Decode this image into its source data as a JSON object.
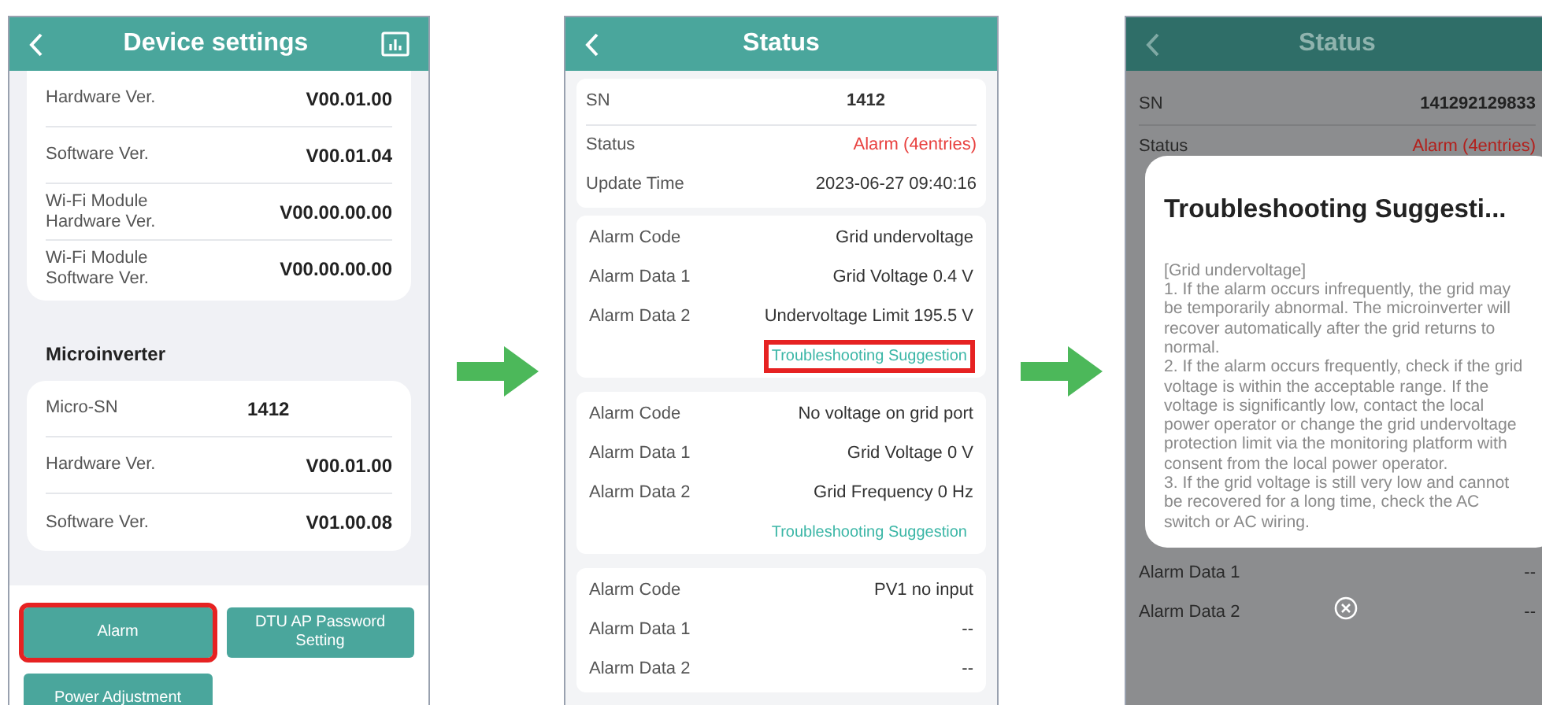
{
  "device_settings_screen": {
    "title": "Device settings",
    "dtu_rows": [
      {
        "label": "Hardware Ver.",
        "value": "V00.01.00"
      },
      {
        "label": "Software Ver.",
        "value": "V00.01.04"
      },
      {
        "label": "Wi-Fi Module Hardware Ver.",
        "value": "V00.00.00.00"
      },
      {
        "label": "Wi-Fi Module Software Ver.",
        "value": "V00.00.00.00"
      }
    ],
    "microinverter_heading": "Microinverter",
    "microinverter_rows": [
      {
        "label": "Micro-SN",
        "value": "1412",
        "kind": "serial"
      },
      {
        "label": "Hardware Ver.",
        "value": "V00.01.00",
        "kind": "version"
      },
      {
        "label": "Software Ver.",
        "value": "V01.00.08",
        "kind": "version"
      }
    ],
    "buttons": [
      {
        "label": "Alarm",
        "highlighted": true
      },
      {
        "label": "DTU AP Password Setting",
        "highlighted": false
      },
      {
        "label": "Power Adjustment",
        "highlighted": false
      }
    ]
  },
  "status_screen": {
    "title": "Status",
    "summary_rows": [
      {
        "label": "SN",
        "value": "1412",
        "kind": "serial"
      },
      {
        "label": "Status",
        "value": "Alarm (4entries)",
        "kind": "alarm"
      },
      {
        "label": "Update Time",
        "value": "2023-06-27 09:40:16",
        "kind": "plain"
      }
    ],
    "alarms": [
      {
        "rows": [
          {
            "label": "Alarm Code",
            "value": "Grid undervoltage"
          },
          {
            "label": "Alarm Data 1",
            "value": "Grid Voltage 0.4 V"
          },
          {
            "label": "Alarm Data 2",
            "value": "Undervoltage Limit 195.5 V"
          }
        ],
        "link": {
          "label": "Troubleshooting Suggestion",
          "highlighted": true
        }
      },
      {
        "rows": [
          {
            "label": "Alarm Code",
            "value": "No voltage on grid port"
          },
          {
            "label": "Alarm Data 1",
            "value": "Grid Voltage 0 V"
          },
          {
            "label": "Alarm Data 2",
            "value": "Grid Frequency 0 Hz"
          }
        ],
        "link": {
          "label": "Troubleshooting Suggestion",
          "highlighted": false
        }
      },
      {
        "rows": [
          {
            "label": "Alarm Code",
            "value": "PV1 no input"
          },
          {
            "label": "Alarm Data 1",
            "value": "--"
          },
          {
            "label": "Alarm Data 2",
            "value": "--"
          }
        ]
      }
    ]
  },
  "dialog_screen": {
    "title": "Status",
    "rows_above": [
      {
        "label": "SN",
        "value": "141292129833",
        "kind": "serial"
      },
      {
        "label": "Status",
        "value": "Alarm (4entries)",
        "kind": "alarm"
      }
    ],
    "dialog": {
      "title": "Troubleshooting Suggesti...",
      "paragraphs": [
        "[Grid undervoltage]",
        "1. If the alarm occurs infrequently, the grid may be temporarily abnormal. The microinverter will recover automatically after the grid returns to normal.",
        "2. If the alarm occurs frequently, check if the grid voltage is within the acceptable range. If the voltage is significantly low, contact the local power operator or change the grid undervoltage protection limit via the monitoring platform with consent from the local power operator.",
        "3. If the grid voltage is still very low and cannot be recovered for a long time, check the AC switch or AC wiring."
      ]
    },
    "rows_below": [
      {
        "label": "Alarm Data 1",
        "value": "--"
      },
      {
        "label": "Alarm Data 2",
        "value": "--"
      }
    ]
  }
}
